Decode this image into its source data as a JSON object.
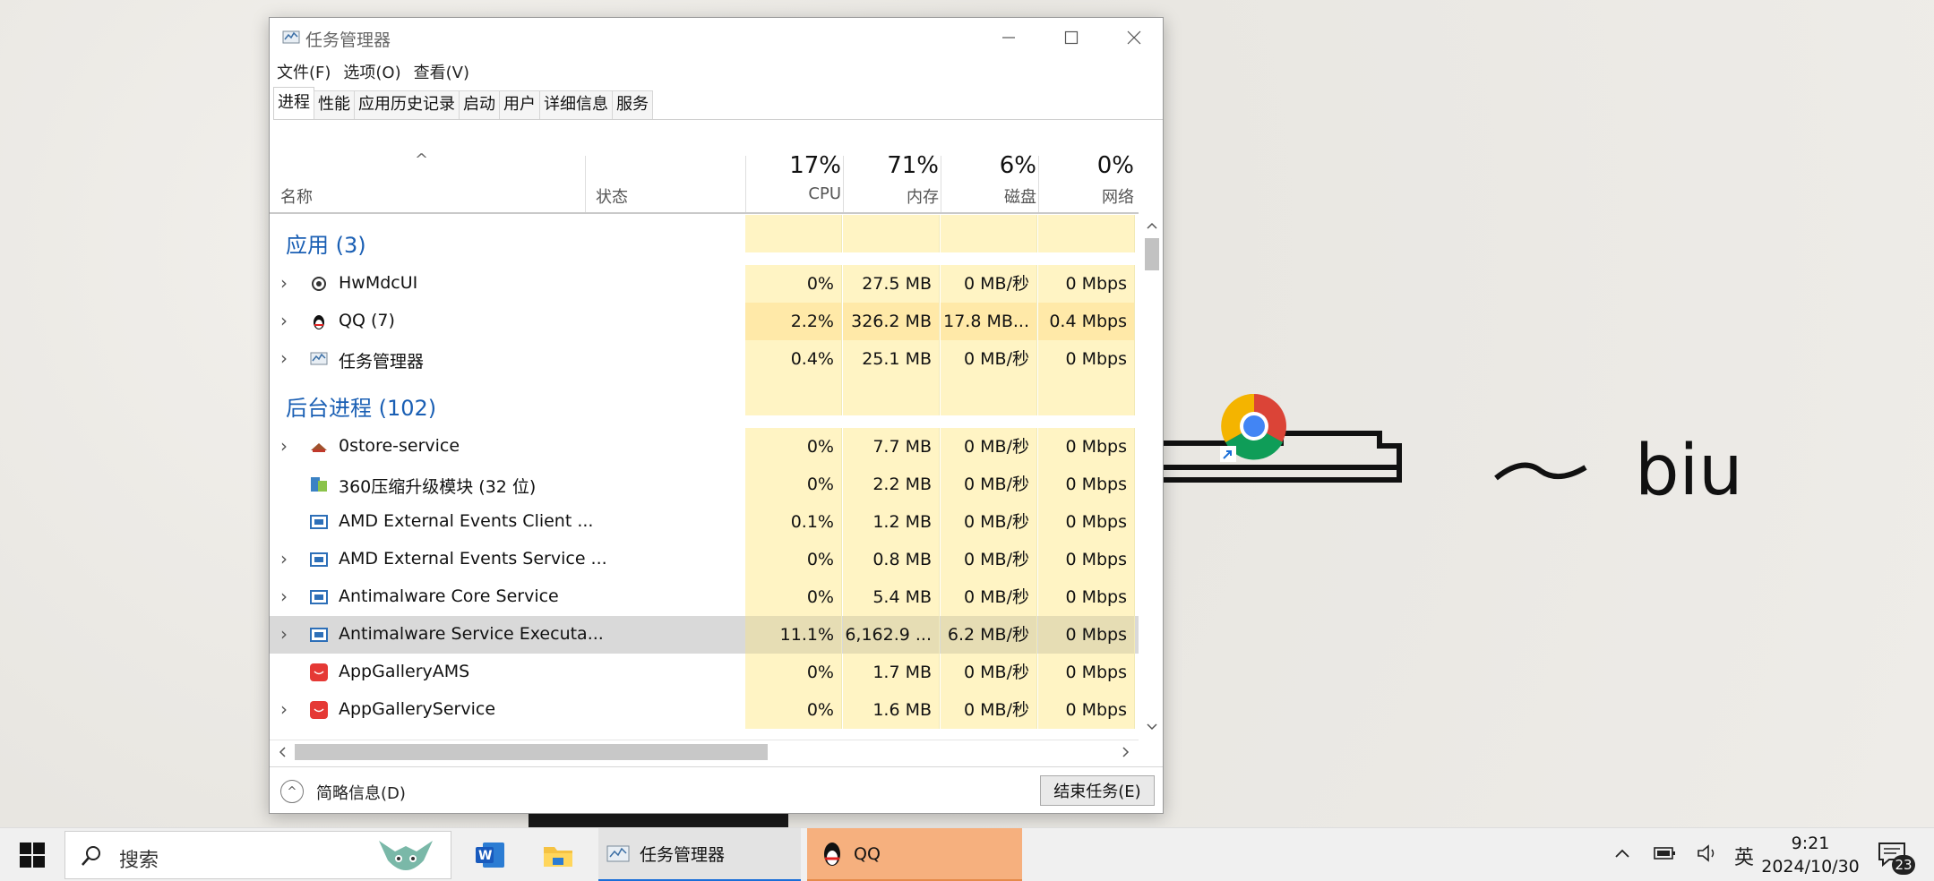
{
  "window": {
    "title": "任务管理器"
  },
  "menu": [
    "文件(F)",
    "选项(O)",
    "查看(V)"
  ],
  "tabs": [
    "进程",
    "性能",
    "应用历史记录",
    "启动",
    "用户",
    "详细信息",
    "服务"
  ],
  "columns": {
    "name": "名称",
    "status": "状态",
    "cpu_pct": "17%",
    "cpu": "CPU",
    "mem_pct": "71%",
    "mem": "内存",
    "disk_pct": "6%",
    "disk": "磁盘",
    "net_pct": "0%",
    "net": "网络"
  },
  "groups": {
    "apps": "应用 (3)",
    "background": "后台进程 (102)"
  },
  "rows": [
    {
      "name": "HwMdcUI",
      "cpu": "0%",
      "mem": "27.5 MB",
      "disk": "0 MB/秒",
      "net": "0 Mbps"
    },
    {
      "name": "QQ (7)",
      "cpu": "2.2%",
      "mem": "326.2 MB",
      "disk": "17.8 MB...",
      "net": "0.4 Mbps"
    },
    {
      "name": "任务管理器",
      "cpu": "0.4%",
      "mem": "25.1 MB",
      "disk": "0 MB/秒",
      "net": "0 Mbps"
    },
    {
      "name": "0store-service",
      "cpu": "0%",
      "mem": "7.7 MB",
      "disk": "0 MB/秒",
      "net": "0 Mbps"
    },
    {
      "name": "360压缩升级模块 (32 位)",
      "cpu": "0%",
      "mem": "2.2 MB",
      "disk": "0 MB/秒",
      "net": "0 Mbps"
    },
    {
      "name": "AMD External Events Client ...",
      "cpu": "0.1%",
      "mem": "1.2 MB",
      "disk": "0 MB/秒",
      "net": "0 Mbps"
    },
    {
      "name": "AMD External Events Service ...",
      "cpu": "0%",
      "mem": "0.8 MB",
      "disk": "0 MB/秒",
      "net": "0 Mbps"
    },
    {
      "name": "Antimalware Core Service",
      "cpu": "0%",
      "mem": "5.4 MB",
      "disk": "0 MB/秒",
      "net": "0 Mbps"
    },
    {
      "name": "Antimalware Service Executa...",
      "cpu": "11.1%",
      "mem": "6,162.9 ...",
      "disk": "6.2 MB/秒",
      "net": "0 Mbps"
    },
    {
      "name": "AppGalleryAMS",
      "cpu": "0%",
      "mem": "1.7 MB",
      "disk": "0 MB/秒",
      "net": "0 Mbps"
    },
    {
      "name": "AppGalleryService",
      "cpu": "0%",
      "mem": "1.6 MB",
      "disk": "0 MB/秒",
      "net": "0 Mbps"
    }
  ],
  "footer": {
    "brief": "简略信息(D)",
    "end_task": "结束任务(E)"
  },
  "taskbar": {
    "search_placeholder": "搜索",
    "task_manager": "任务管理器",
    "qq": "QQ",
    "ime": "英",
    "time": "9:21",
    "date": "2024/10/30",
    "notifications": "23"
  },
  "colors": {
    "accent": "#1a6ed8",
    "group_text": "#1a5fb4",
    "cell_bg": "#fff4c4",
    "qq_task": "#f6b07e"
  }
}
